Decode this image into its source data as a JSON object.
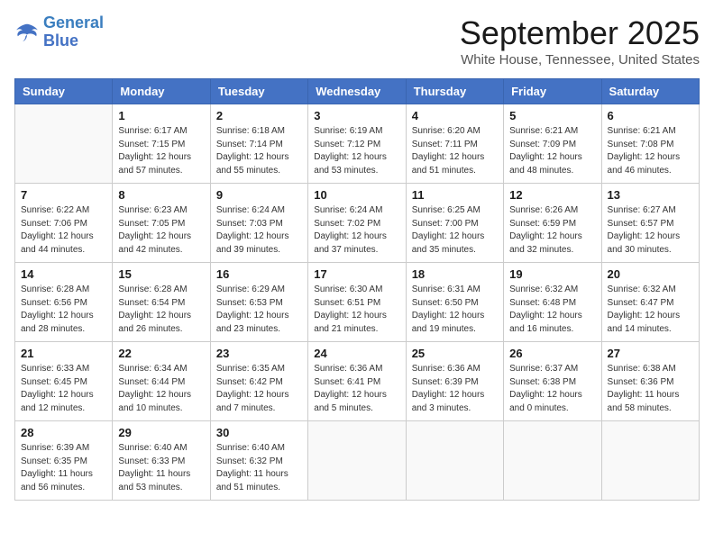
{
  "logo": {
    "line1": "General",
    "line2": "Blue"
  },
  "title": "September 2025",
  "location": "White House, Tennessee, United States",
  "days_of_week": [
    "Sunday",
    "Monday",
    "Tuesday",
    "Wednesday",
    "Thursday",
    "Friday",
    "Saturday"
  ],
  "weeks": [
    [
      {
        "day": "",
        "info": ""
      },
      {
        "day": "1",
        "info": "Sunrise: 6:17 AM\nSunset: 7:15 PM\nDaylight: 12 hours\nand 57 minutes."
      },
      {
        "day": "2",
        "info": "Sunrise: 6:18 AM\nSunset: 7:14 PM\nDaylight: 12 hours\nand 55 minutes."
      },
      {
        "day": "3",
        "info": "Sunrise: 6:19 AM\nSunset: 7:12 PM\nDaylight: 12 hours\nand 53 minutes."
      },
      {
        "day": "4",
        "info": "Sunrise: 6:20 AM\nSunset: 7:11 PM\nDaylight: 12 hours\nand 51 minutes."
      },
      {
        "day": "5",
        "info": "Sunrise: 6:21 AM\nSunset: 7:09 PM\nDaylight: 12 hours\nand 48 minutes."
      },
      {
        "day": "6",
        "info": "Sunrise: 6:21 AM\nSunset: 7:08 PM\nDaylight: 12 hours\nand 46 minutes."
      }
    ],
    [
      {
        "day": "7",
        "info": "Sunrise: 6:22 AM\nSunset: 7:06 PM\nDaylight: 12 hours\nand 44 minutes."
      },
      {
        "day": "8",
        "info": "Sunrise: 6:23 AM\nSunset: 7:05 PM\nDaylight: 12 hours\nand 42 minutes."
      },
      {
        "day": "9",
        "info": "Sunrise: 6:24 AM\nSunset: 7:03 PM\nDaylight: 12 hours\nand 39 minutes."
      },
      {
        "day": "10",
        "info": "Sunrise: 6:24 AM\nSunset: 7:02 PM\nDaylight: 12 hours\nand 37 minutes."
      },
      {
        "day": "11",
        "info": "Sunrise: 6:25 AM\nSunset: 7:00 PM\nDaylight: 12 hours\nand 35 minutes."
      },
      {
        "day": "12",
        "info": "Sunrise: 6:26 AM\nSunset: 6:59 PM\nDaylight: 12 hours\nand 32 minutes."
      },
      {
        "day": "13",
        "info": "Sunrise: 6:27 AM\nSunset: 6:57 PM\nDaylight: 12 hours\nand 30 minutes."
      }
    ],
    [
      {
        "day": "14",
        "info": "Sunrise: 6:28 AM\nSunset: 6:56 PM\nDaylight: 12 hours\nand 28 minutes."
      },
      {
        "day": "15",
        "info": "Sunrise: 6:28 AM\nSunset: 6:54 PM\nDaylight: 12 hours\nand 26 minutes."
      },
      {
        "day": "16",
        "info": "Sunrise: 6:29 AM\nSunset: 6:53 PM\nDaylight: 12 hours\nand 23 minutes."
      },
      {
        "day": "17",
        "info": "Sunrise: 6:30 AM\nSunset: 6:51 PM\nDaylight: 12 hours\nand 21 minutes."
      },
      {
        "day": "18",
        "info": "Sunrise: 6:31 AM\nSunset: 6:50 PM\nDaylight: 12 hours\nand 19 minutes."
      },
      {
        "day": "19",
        "info": "Sunrise: 6:32 AM\nSunset: 6:48 PM\nDaylight: 12 hours\nand 16 minutes."
      },
      {
        "day": "20",
        "info": "Sunrise: 6:32 AM\nSunset: 6:47 PM\nDaylight: 12 hours\nand 14 minutes."
      }
    ],
    [
      {
        "day": "21",
        "info": "Sunrise: 6:33 AM\nSunset: 6:45 PM\nDaylight: 12 hours\nand 12 minutes."
      },
      {
        "day": "22",
        "info": "Sunrise: 6:34 AM\nSunset: 6:44 PM\nDaylight: 12 hours\nand 10 minutes."
      },
      {
        "day": "23",
        "info": "Sunrise: 6:35 AM\nSunset: 6:42 PM\nDaylight: 12 hours\nand 7 minutes."
      },
      {
        "day": "24",
        "info": "Sunrise: 6:36 AM\nSunset: 6:41 PM\nDaylight: 12 hours\nand 5 minutes."
      },
      {
        "day": "25",
        "info": "Sunrise: 6:36 AM\nSunset: 6:39 PM\nDaylight: 12 hours\nand 3 minutes."
      },
      {
        "day": "26",
        "info": "Sunrise: 6:37 AM\nSunset: 6:38 PM\nDaylight: 12 hours\nand 0 minutes."
      },
      {
        "day": "27",
        "info": "Sunrise: 6:38 AM\nSunset: 6:36 PM\nDaylight: 11 hours\nand 58 minutes."
      }
    ],
    [
      {
        "day": "28",
        "info": "Sunrise: 6:39 AM\nSunset: 6:35 PM\nDaylight: 11 hours\nand 56 minutes."
      },
      {
        "day": "29",
        "info": "Sunrise: 6:40 AM\nSunset: 6:33 PM\nDaylight: 11 hours\nand 53 minutes."
      },
      {
        "day": "30",
        "info": "Sunrise: 6:40 AM\nSunset: 6:32 PM\nDaylight: 11 hours\nand 51 minutes."
      },
      {
        "day": "",
        "info": ""
      },
      {
        "day": "",
        "info": ""
      },
      {
        "day": "",
        "info": ""
      },
      {
        "day": "",
        "info": ""
      }
    ]
  ]
}
